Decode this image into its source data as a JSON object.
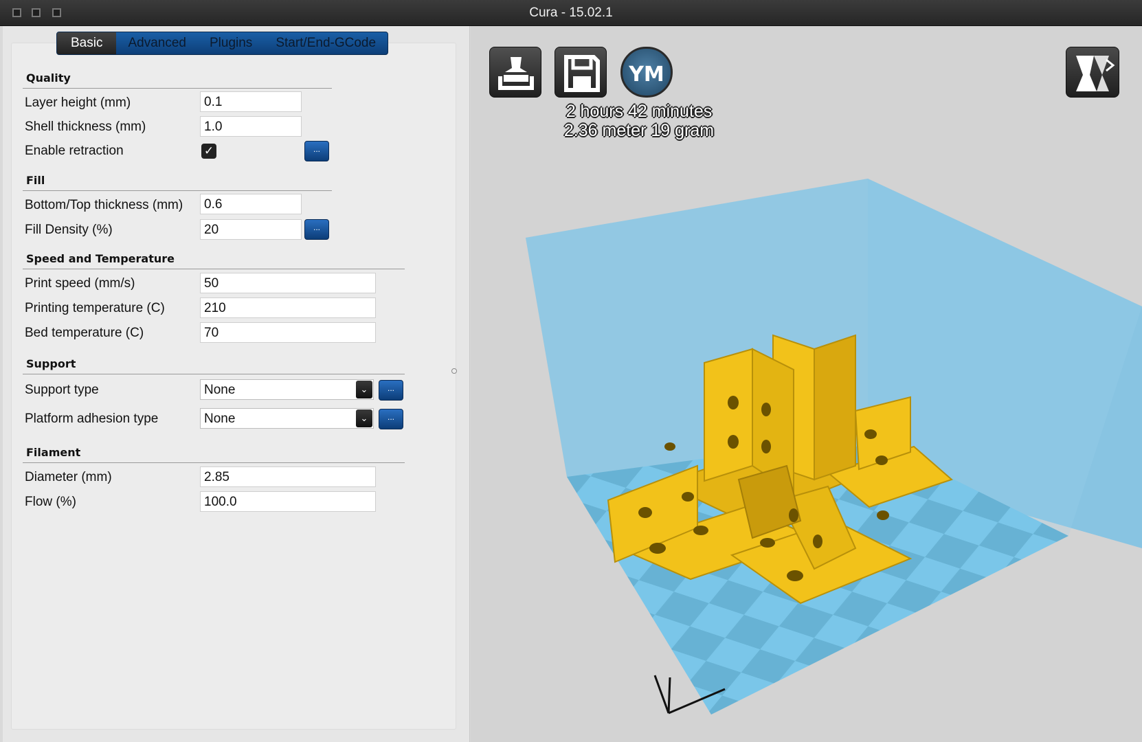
{
  "window": {
    "title": "Cura - 15.02.1"
  },
  "tabs": [
    {
      "label": "Basic",
      "active": true
    },
    {
      "label": "Advanced",
      "active": false
    },
    {
      "label": "Plugins",
      "active": false
    },
    {
      "label": "Start/End-GCode",
      "active": false
    }
  ],
  "quality": {
    "title": "Quality",
    "layer_height_label": "Layer height (mm)",
    "layer_height_value": "0.1",
    "shell_thickness_label": "Shell thickness (mm)",
    "shell_thickness_value": "1.0",
    "retraction_label": "Enable retraction",
    "retraction_checked": true
  },
  "fill": {
    "title": "Fill",
    "bottom_top_label": "Bottom/Top thickness (mm)",
    "bottom_top_value": "0.6",
    "density_label": "Fill Density (%)",
    "density_value": "20"
  },
  "speed": {
    "title": "Speed and Temperature",
    "print_speed_label": "Print speed (mm/s)",
    "print_speed_value": "50",
    "print_temp_label": "Printing temperature (C)",
    "print_temp_value": "210",
    "bed_temp_label": "Bed temperature (C)",
    "bed_temp_value": "70"
  },
  "support": {
    "title": "Support",
    "support_type_label": "Support type",
    "support_type_value": "None",
    "adhesion_label": "Platform adhesion type",
    "adhesion_value": "None"
  },
  "filament": {
    "title": "Filament",
    "diameter_label": "Diameter (mm)",
    "diameter_value": "2.85",
    "flow_label": "Flow (%)",
    "flow_value": "100.0"
  },
  "common": {
    "dots_label": "...",
    "check_mark": "✓",
    "dropdown_arrow": "⌄"
  },
  "viewport": {
    "ym_label": "YM",
    "print_time": "2 hours 42 minutes",
    "print_material": "2.36 meter 19 gram",
    "colors": {
      "build_volume": "#8fc6e0",
      "bed_light": "#6fc3e8",
      "bed_dark": "#56a9cc",
      "model": "#f2c21a"
    }
  }
}
